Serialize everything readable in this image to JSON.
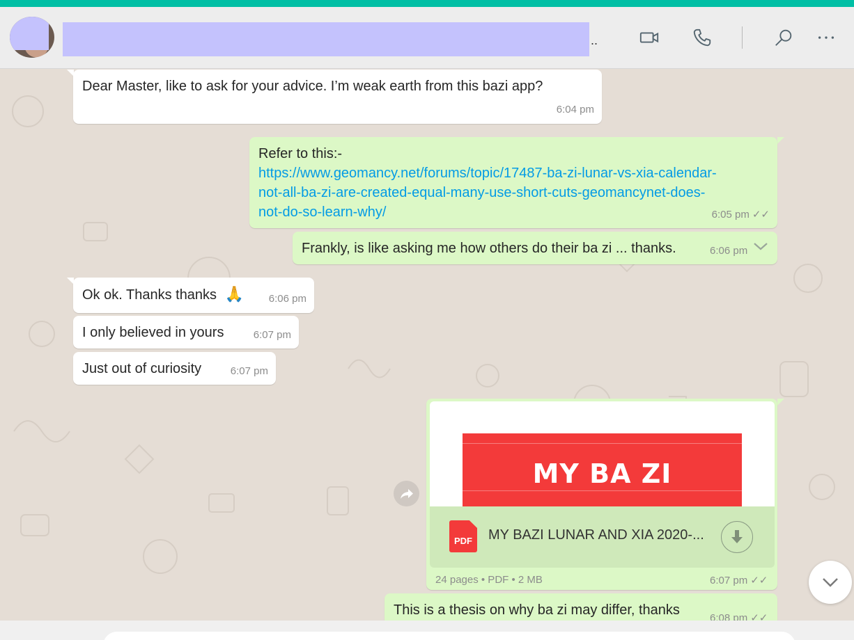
{
  "theme": {
    "accent": "#00bfa5",
    "incoming_bubble": "#ffffff",
    "outgoing_bubble": "#dcf8c6",
    "link": "#039be5",
    "pdf_red": "#f33a3a"
  },
  "header": {
    "ellipsis": "..",
    "icons": [
      "video-call-icon",
      "voice-call-icon",
      "search-icon",
      "more-options-icon"
    ]
  },
  "messages": [
    {
      "id": "m1",
      "dir": "in",
      "text": "Dear Master, like to ask for your advice. I’m weak earth from this bazi app?",
      "time": "6:04 pm"
    },
    {
      "id": "m2",
      "dir": "out",
      "prefix": "Refer to this:-",
      "link_lines": [
        "https://www.geomancy.net/forums/topic/17487-ba-zi-lunar-vs-xia-calendar-",
        "not-all-ba-zi-are-created-equal-many-use-short-cuts-geomancynet-does-",
        "not-do-so-learn-why/"
      ],
      "time": "6:05 pm",
      "ticks": "✓✓"
    },
    {
      "id": "m3",
      "dir": "out",
      "text": "Frankly, is like asking me how others do their ba zi ... thanks.",
      "time": "6:06 pm"
    },
    {
      "id": "m4",
      "dir": "in",
      "text": "Ok ok. Thanks thanks",
      "emoji": "🙏",
      "time": "6:06 pm"
    },
    {
      "id": "m5",
      "dir": "in",
      "text": "I only believed in yours",
      "time": "6:07 pm"
    },
    {
      "id": "m6",
      "dir": "in",
      "text": "Just out of curiosity",
      "time": "6:07 pm"
    },
    {
      "id": "m7",
      "dir": "out",
      "type": "document",
      "preview_text": "MY BA ZI",
      "pdf_label": "PDF",
      "file_name": "MY BAZI LUNAR AND XIA 2020-...",
      "meta": "24 pages • PDF • 2 MB",
      "time": "6:07 pm",
      "ticks": "✓✓"
    },
    {
      "id": "m8",
      "dir": "out",
      "text": "This is a thesis on why ba zi may differ, thanks",
      "time": "6:08 pm",
      "ticks": "✓✓"
    }
  ]
}
